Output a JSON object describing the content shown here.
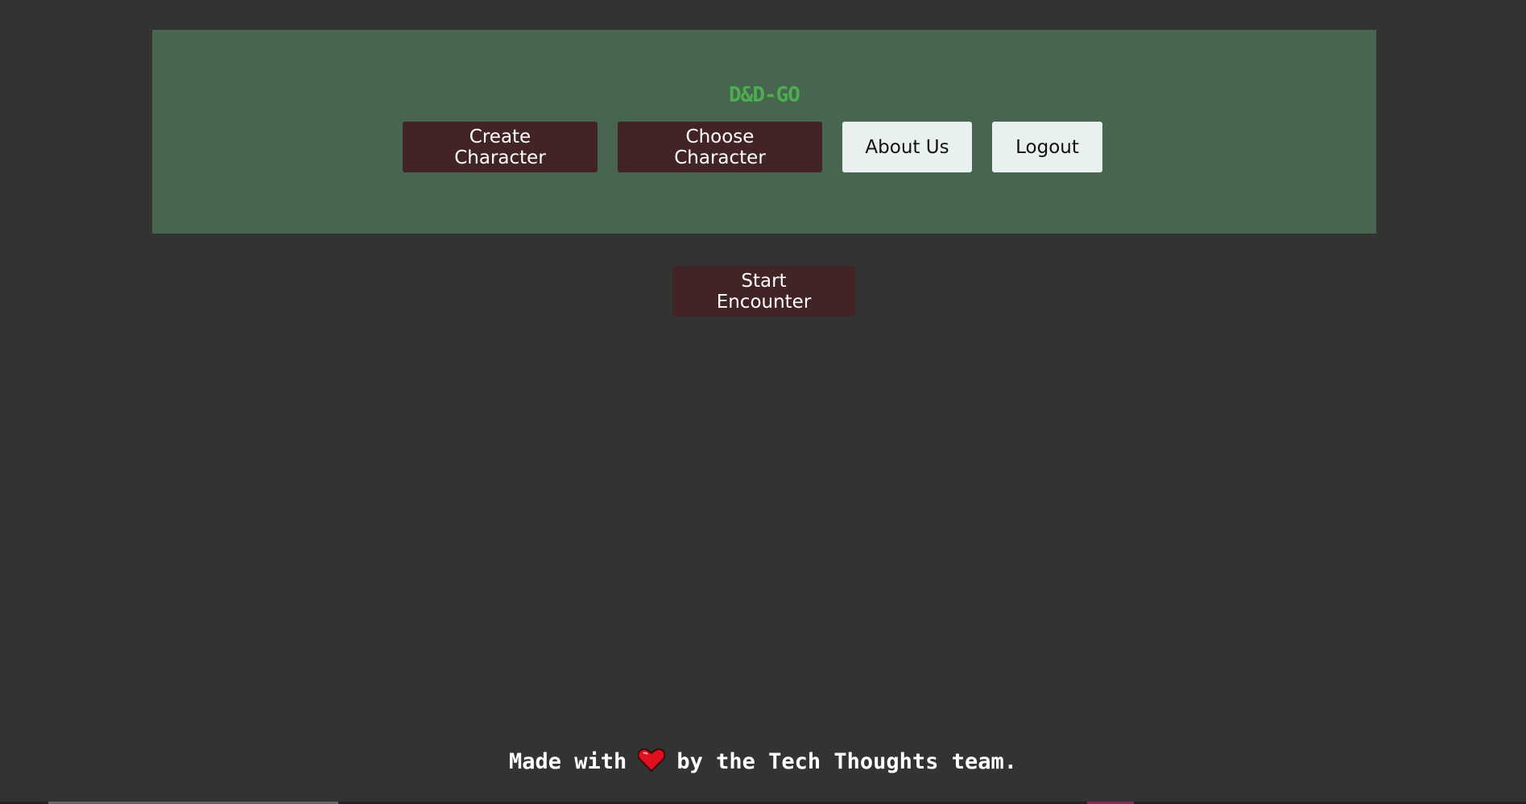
{
  "header": {
    "brand": "D&D-GO",
    "nav": {
      "create_character": "Create Character",
      "choose_character": "Choose Character",
      "about_us": "About Us",
      "logout": "Logout"
    }
  },
  "main": {
    "start_encounter": "Start Encounter"
  },
  "footer": {
    "text_before": "Made with",
    "icon": "heart-icon",
    "text_after": "by the Tech Thoughts team."
  },
  "colors": {
    "page_background": "#333333",
    "header_background": "#48664f",
    "brand_text": "#4cae4f",
    "dark_button": "#422426",
    "light_button": "#e9f1f0",
    "heart": "#e0101e"
  }
}
